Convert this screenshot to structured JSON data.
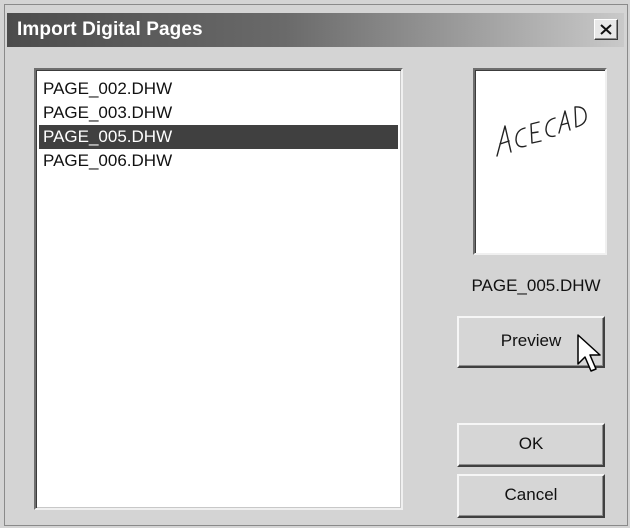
{
  "window": {
    "title": "Import Digital Pages"
  },
  "icons": {
    "close": "close-icon",
    "cursor": "mouse-pointer-icon"
  },
  "file_list": {
    "items": [
      "PAGE_002.DHW",
      "PAGE_003.DHW",
      "PAGE_005.DHW",
      "PAGE_006.DHW"
    ],
    "selected_index": 2
  },
  "preview": {
    "handwriting_text": "ACECAD",
    "file_name": "PAGE_005.DHW"
  },
  "buttons": {
    "preview_label": "Preview",
    "ok_label": "OK",
    "cancel_label": "Cancel"
  },
  "colors": {
    "selection_bg": "#404040",
    "dialog_bg": "#d4d4d4"
  }
}
